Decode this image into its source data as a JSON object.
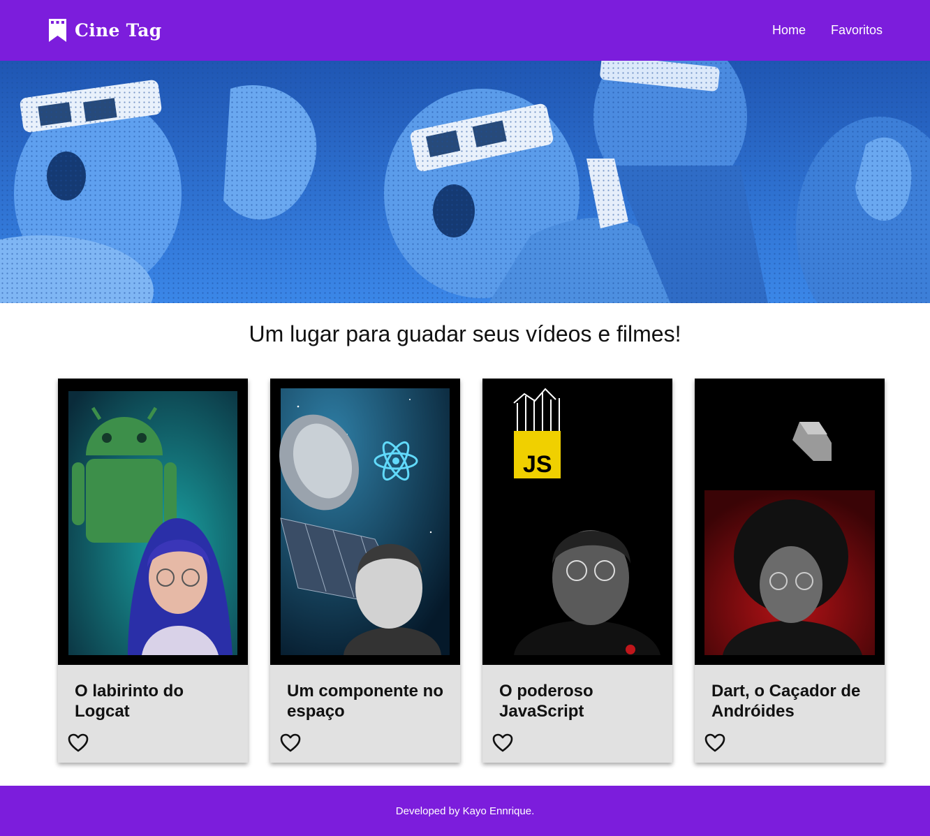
{
  "header": {
    "logo_text": "Cine Tag",
    "logo_icon": "bookmark-film-icon",
    "nav": [
      {
        "label": "Home"
      },
      {
        "label": "Favoritos"
      }
    ]
  },
  "banner": {
    "alt": "3d-cinema-audience-banner"
  },
  "main": {
    "headline": "Um lugar para guadar seus vídeos e filmes!"
  },
  "cards": [
    {
      "title": "O labirinto do Logcat",
      "favorite_icon": "heart-outline-icon"
    },
    {
      "title": "Um componente no espaço",
      "favorite_icon": "heart-outline-icon"
    },
    {
      "title": "O poderoso JavaScript",
      "favorite_icon": "heart-outline-icon"
    },
    {
      "title": "Dart, o Caçador de Andróides",
      "favorite_icon": "heart-outline-icon"
    }
  ],
  "footer": {
    "text": "Developed by Kayo Ennrique."
  },
  "colors": {
    "primary": "#7c1ddc",
    "banner_blue": "#2a6fd6",
    "card_bg": "#e1e1e1"
  }
}
